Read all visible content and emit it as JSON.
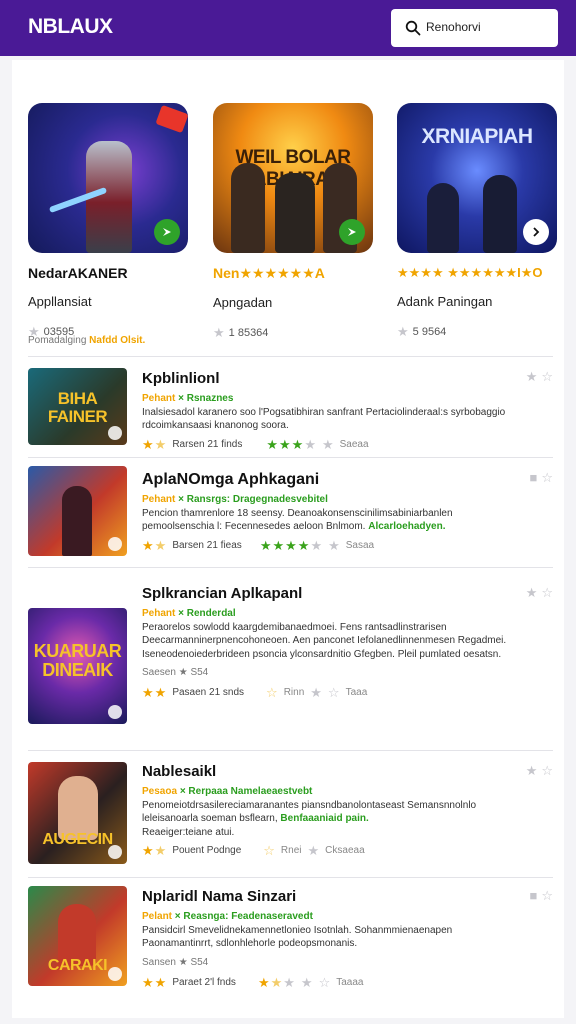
{
  "app": {
    "logo": "NBLAUX"
  },
  "search": {
    "text": "Renohorvi"
  },
  "featured": [
    {
      "badge": "",
      "name": "NedarAKANER",
      "sub": "Appllansiat",
      "rating": "03595",
      "play_icon": "play-arrow-icon",
      "colors": [
        "#1f2a7a",
        "#6a1e8a"
      ]
    },
    {
      "badge": "",
      "art": "WEIL BOLAR ABIAIRAI",
      "name": "Nen★★★★★★A",
      "sub": "Apngadan",
      "rating": "1 85364",
      "play_icon": "play-arrow-icon",
      "colors": [
        "#f08a12",
        "#6a3410"
      ]
    },
    {
      "badge": "",
      "art": "XRNIAPIAH",
      "name": "★★★★ ★★★★★★I★O",
      "sub": "Adank Paningan",
      "rating": "5 9564",
      "play_icon": "chevron-right-icon",
      "colors": [
        "#0e1660",
        "#3a2a8a"
      ]
    }
  ],
  "promo": {
    "prefix": "Pomadalging ",
    "highlight": "Nafdd Olsit."
  },
  "list": [
    {
      "art": "BIHA FAINER",
      "title": "Kpblinlionl",
      "tags_yellow": "Pehant",
      "tags_green": "× Rsnaznes",
      "desc": "Inalsiesadol karanero soo l'Pogsatibhiran sanfrant Pertaciolinderaal:s syrbobaggio rdcoimkansaasi knanonog soora.",
      "meta": "Rarsen 21 finds",
      "extra": "Saeaa"
    },
    {
      "art": "",
      "title": "AplaNOmga Aphkagani",
      "tags_yellow": "Pehant",
      "tags_green": "× Ransrgs: Dragegnadesvebitel",
      "desc": "Pencion thamrenlore 18 seensy. Deanoakonsenscinilimsabiniarbanlen pemoolsenschia l: Fecennesedes aeloon Bnlmom. ",
      "desc_green": "Alcarloehadyen.",
      "meta": "Barsen 21 fieas",
      "extra": "Sasaa"
    },
    {
      "art": "KUARUAR DINEAIK",
      "title": "Splkrancian Aplkapanl",
      "tags_yellow": "Pehant",
      "tags_green": "× Renderdal",
      "desc": "Peraorelos sowlodd kaargdemibanaedmoei. Fens rantsadlinstrarisen Deecarmanninerpnencohoneoen. Aen panconet Iefolanedlinnenmesen Regadmei. Iseneodenoiederbrideen psoncia ylconsardnitio Gfegben. Pleil pumlated oesatsn.",
      "meta": "Saesen ★ S54",
      "meta2": "Pasaen 21 snds",
      "extra": "Rinn",
      "extra2": "Taaa"
    },
    {
      "art": "AUGECIN",
      "title": "Nablesaikl",
      "tags_yellow": "Pesaoa",
      "tags_green": "× Rerpaaa Namelaeaestvebt",
      "desc": "Penomeiotdrsasilereciamaranantes piansndbanolontaseast Semansnnolnlo leleisanoarla soeman bsflearn, ",
      "desc_green": "Benfaaaniaid pain.",
      "desc2": "Reaeiger:teiane atui.",
      "meta": "Pouent Podnge",
      "extra": "Rnei",
      "extra2": "Cksaeaa"
    },
    {
      "art": "CARAKI",
      "title": "Nplaridl Nama Sinzari",
      "tags_yellow": "Pelant",
      "tags_green": "× Reasnga: Feadenaseravedt",
      "desc": "Pansidcirl Smevelidnekamennetlonieo Isotnlah. Sohanmmienaenapen Paonamantinrrt, sdlonhlehorle podeopsmonanis.",
      "meta_top": "Sansen ★ S54",
      "meta": "Paraet 2'l fnds",
      "extra": "Taaaa"
    }
  ],
  "colors": {
    "brand": "#4a1a96",
    "accent_gold": "#f0a400",
    "accent_green": "#2a9d1e"
  }
}
